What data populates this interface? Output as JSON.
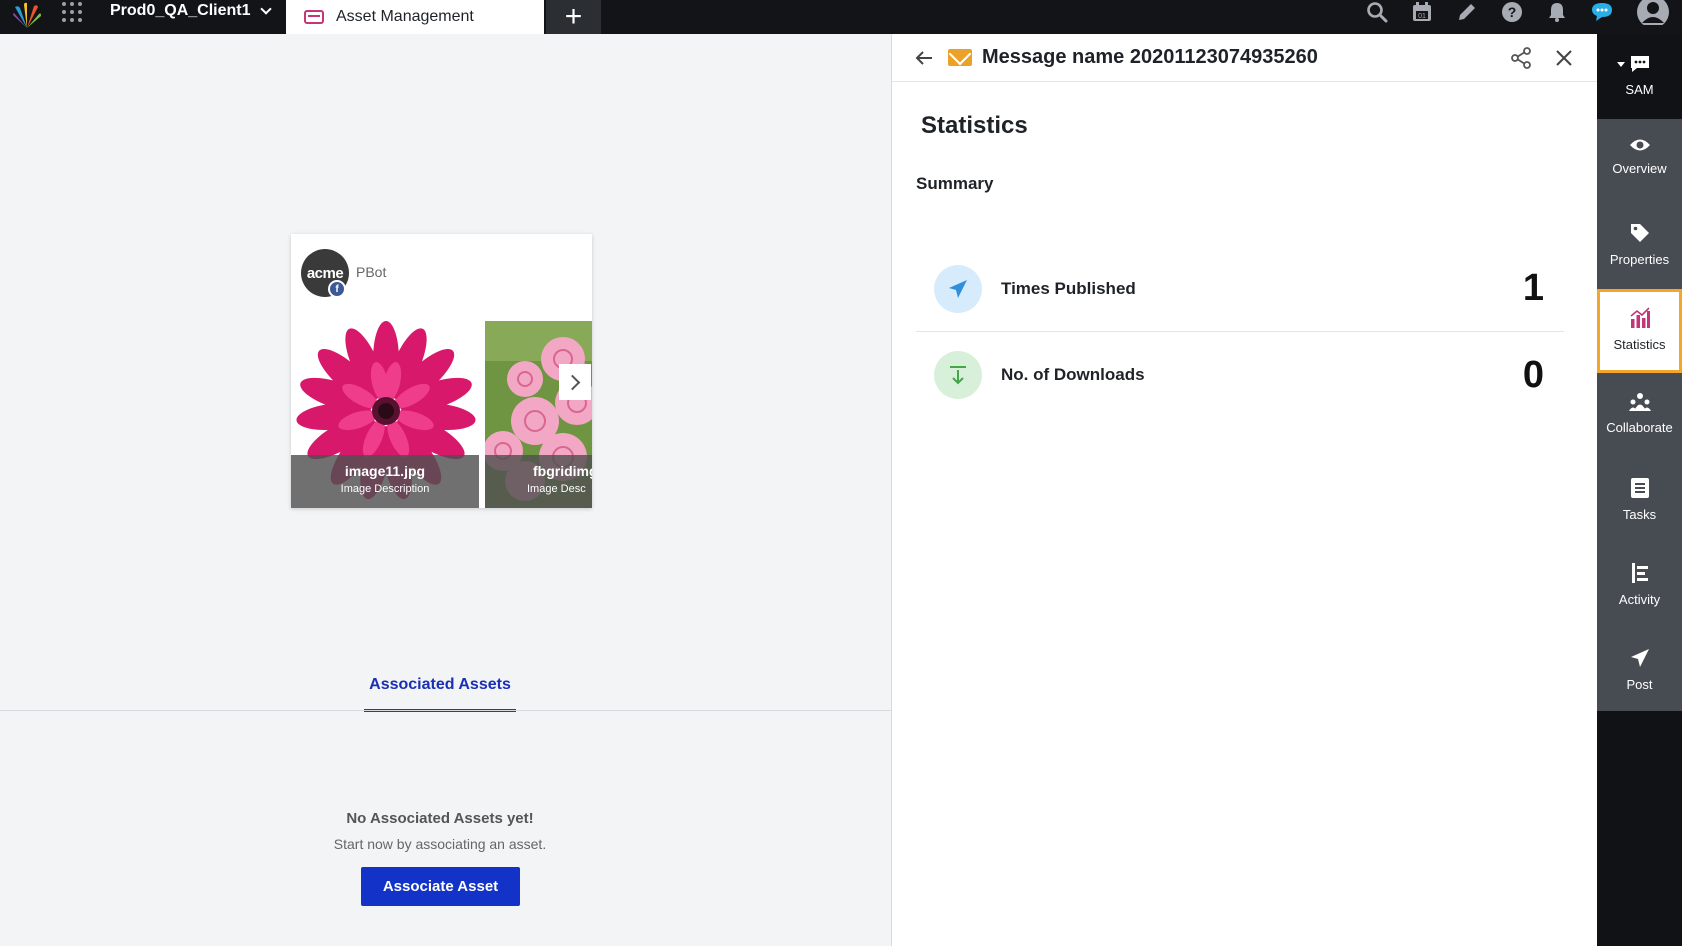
{
  "topbar": {
    "workspace": "Prod0_QA_Client1",
    "active_tab": "Asset Management",
    "add_tab": "+"
  },
  "post": {
    "author_avatar": "acme",
    "author": "PBot",
    "media": [
      {
        "title": "image11.jpg",
        "desc": "Image Description"
      },
      {
        "title": "fbgridimg",
        "desc": "Image Desc"
      }
    ]
  },
  "associated": {
    "tab": "Associated Assets",
    "empty_title": "No Associated Assets yet!",
    "empty_sub": "Start now by associating an asset.",
    "button": "Associate Asset"
  },
  "panel": {
    "title": "Message name 20201123074935260",
    "section": "Statistics",
    "summary": "Summary",
    "stats": [
      {
        "label": "Times Published",
        "value": "1"
      },
      {
        "label": "No. of Downloads",
        "value": "0"
      }
    ]
  },
  "rail": {
    "sam": "SAM",
    "items": [
      "Overview",
      "Properties",
      "Statistics",
      "Collaborate",
      "Tasks",
      "Activity",
      "Post"
    ]
  },
  "colors": {
    "primary": "#1232c8",
    "tab_accent": "#c2367a",
    "active_outline": "#f4a52c",
    "mail": "#eba228"
  }
}
